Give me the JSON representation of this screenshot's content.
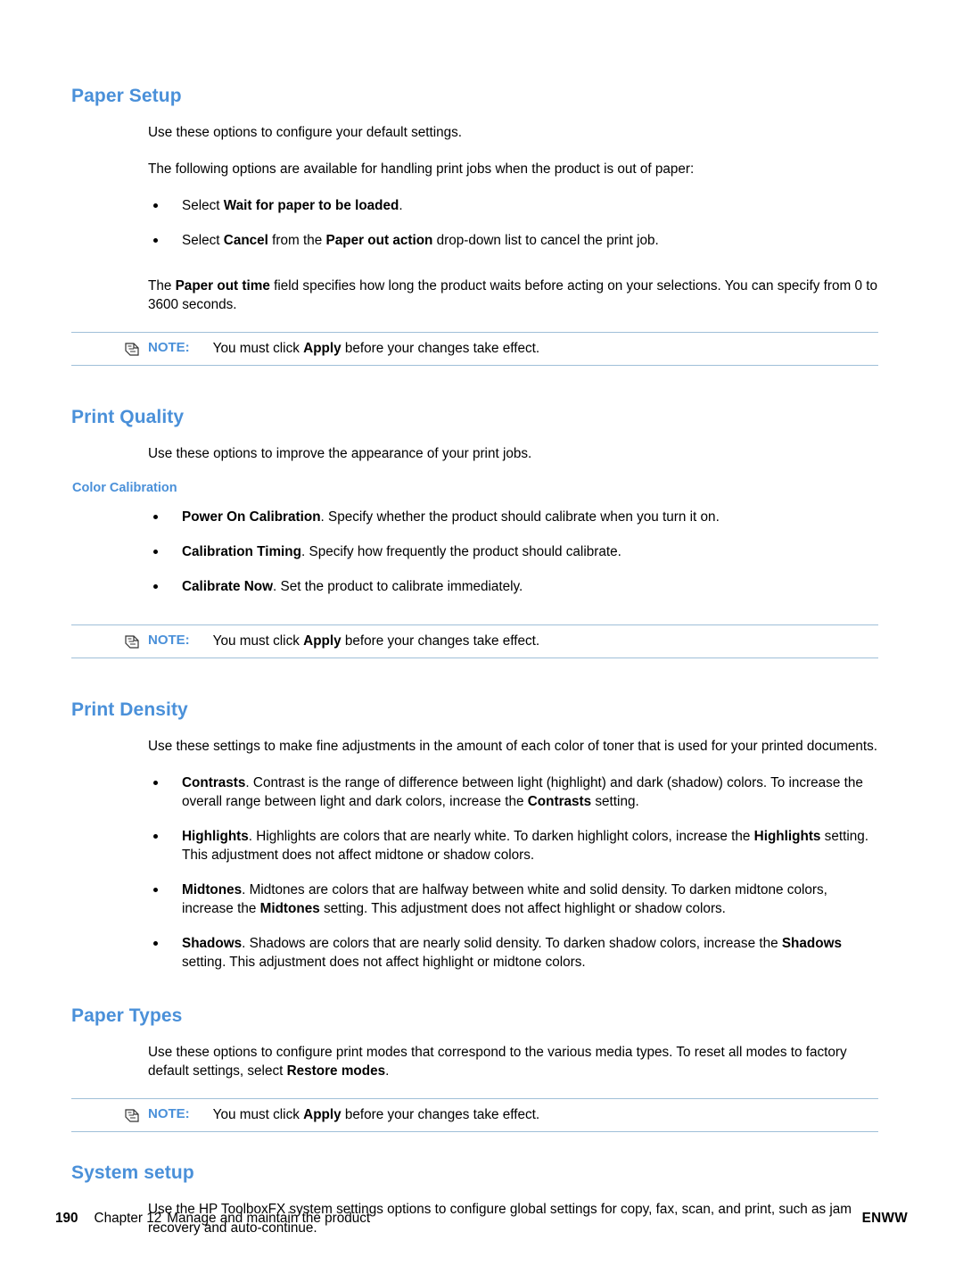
{
  "sections": {
    "paper_setup": {
      "title": "Paper Setup",
      "intro": "Use these options to configure your default settings.",
      "intro2": "The following options are available for handling print jobs when the product is out of paper:",
      "bullets": [
        {
          "pre": "Select ",
          "bold": "Wait for paper to be loaded",
          "post": "."
        },
        {
          "pre": "Select ",
          "bold": "Cancel",
          "mid": " from the ",
          "bold2": "Paper out action",
          "post": " drop-down list to cancel the print job."
        }
      ],
      "paragraph": {
        "pre": "The ",
        "bold": "Paper out time",
        "post": " field specifies how long the product waits before acting on your selections. You can specify from 0 to 3600 seconds."
      },
      "note": {
        "label": "NOTE:",
        "pre": "You must click ",
        "bold": "Apply",
        "post": " before your changes take effect."
      }
    },
    "print_quality": {
      "title": "Print Quality",
      "intro": "Use these options to improve the appearance of your print jobs.",
      "subtitle": "Color Calibration",
      "bullets": [
        {
          "bold": "Power On Calibration",
          "post": ". Specify whether the product should calibrate when you turn it on."
        },
        {
          "bold": "Calibration Timing",
          "post": ". Specify how frequently the product should calibrate."
        },
        {
          "bold": "Calibrate Now",
          "post": ". Set the product to calibrate immediately."
        }
      ],
      "note": {
        "label": "NOTE:",
        "pre": "You must click ",
        "bold": "Apply",
        "post": " before your changes take effect."
      }
    },
    "print_density": {
      "title": "Print Density",
      "intro": "Use these settings to make fine adjustments in the amount of each color of toner that is used for your printed documents.",
      "bullets": [
        {
          "bold": "Contrasts",
          "mid": ". Contrast is the range of difference between light (highlight) and dark (shadow) colors. To increase the overall range between light and dark colors, increase the ",
          "bold2": "Contrasts",
          "post": " setting."
        },
        {
          "bold": "Highlights",
          "mid": ". Highlights are colors that are nearly white. To darken highlight colors, increase the ",
          "bold2": "Highlights",
          "post": " setting. This adjustment does not affect midtone or shadow colors."
        },
        {
          "bold": "Midtones",
          "mid": ". Midtones are colors that are halfway between white and solid density. To darken midtone colors, increase the ",
          "bold2": "Midtones",
          "post": " setting. This adjustment does not affect highlight or shadow colors."
        },
        {
          "bold": "Shadows",
          "mid": ". Shadows are colors that are nearly solid density. To darken shadow colors, increase the ",
          "bold2": "Shadows",
          "post": " setting. This adjustment does not affect highlight or midtone colors."
        }
      ]
    },
    "paper_types": {
      "title": "Paper Types",
      "intro": {
        "pre": "Use these options to configure print modes that correspond to the various media types. To reset all modes to factory default settings, select ",
        "bold": "Restore modes",
        "post": "."
      },
      "note": {
        "label": "NOTE:",
        "pre": "You must click ",
        "bold": "Apply",
        "post": " before your changes take effect."
      }
    },
    "system_setup": {
      "title": "System setup",
      "intro": "Use the HP ToolboxFX system settings options to configure global settings for copy, fax, scan, and print, such as jam recovery and auto-continue."
    }
  },
  "footer": {
    "page_number": "190",
    "chapter_label": "Chapter 12",
    "chapter_title": "Manage and maintain the product",
    "right": "ENWW"
  },
  "colors": {
    "heading_blue": "#4a90d9",
    "note_rule": "#9fbfd8"
  }
}
